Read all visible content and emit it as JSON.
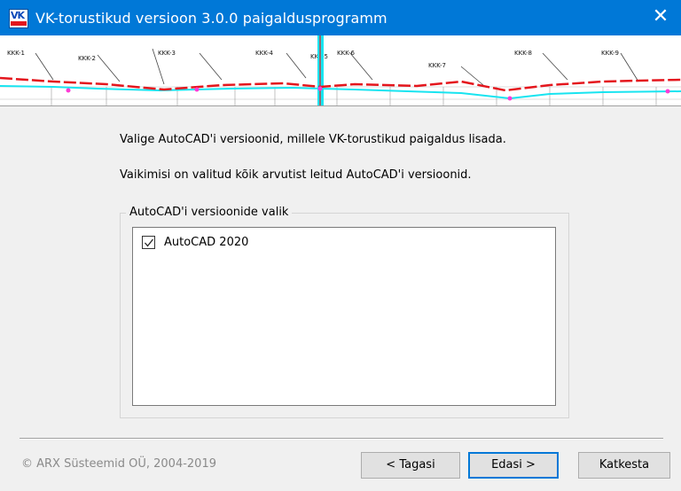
{
  "window": {
    "title": "VK-torustikud versioon 3.0.0 paigaldusprogramm",
    "icon_text": "VK",
    "close_symbol": "✕"
  },
  "banner": {
    "labels": [
      "KKK-1",
      "KKK-2",
      "KKK-3",
      "KKK-4",
      "KKK-5",
      "KKK-6",
      "KKK-7",
      "KKK-8",
      "KKK-9"
    ]
  },
  "main": {
    "instruction": "Valige AutoCAD'i versioonid, millele VK-torustikud paigaldus lisada.",
    "default_note": "Vaikimisi on valitud kõik arvutist leitud AutoCAD'i versioonid.",
    "group_title": "AutoCAD'i versioonide valik",
    "versions": [
      {
        "label": "AutoCAD 2020",
        "checked": true
      }
    ]
  },
  "footer": {
    "copyright": "© ARX Süsteemid OÜ, 2004-2019",
    "back_label": "< Tagasi",
    "next_label": "Edasi >",
    "cancel_label": "Katkesta"
  },
  "colors": {
    "titlebar": "#0078d7",
    "red_line": "#e4161d",
    "cyan_line": "#18e4f0",
    "marker": "#ff3bd6"
  }
}
